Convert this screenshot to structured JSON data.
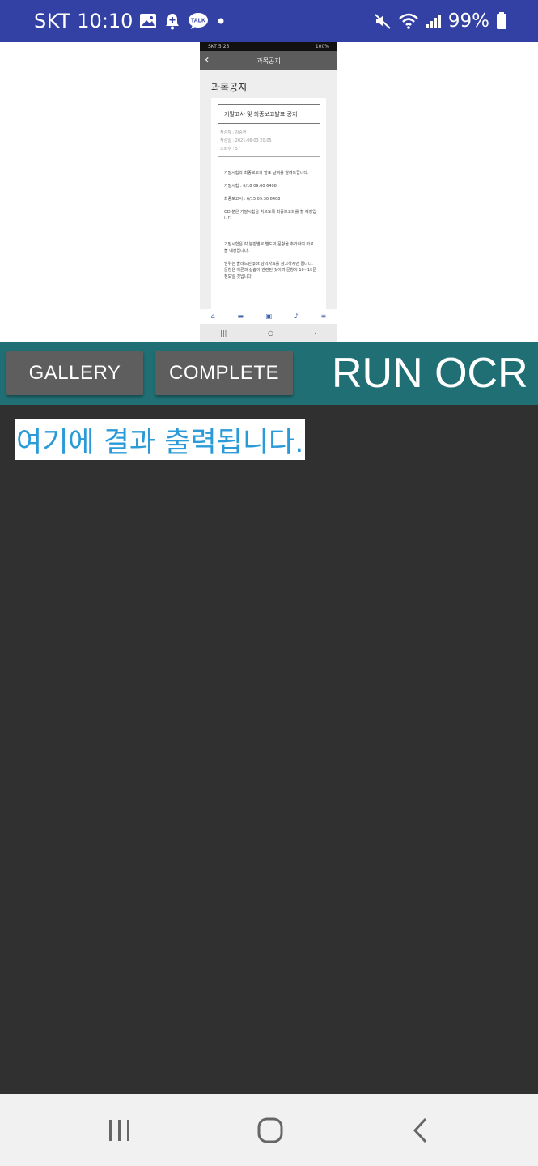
{
  "status_bar": {
    "carrier": "SKT",
    "time": "10:10",
    "battery": "99%",
    "left_icons": [
      "gallery-icon",
      "notification-icon",
      "talk-icon",
      "dot-icon"
    ],
    "talk_badge": "TALK",
    "right_icons": [
      "mute-icon",
      "wifi-icon",
      "signal-icon",
      "battery-icon"
    ]
  },
  "preview": {
    "status_left": "SKT 5:25",
    "status_right": "100%",
    "header_title": "과목공지",
    "page_title": "과목공지",
    "card_title": "기말고사 및 최종보고발표 공지",
    "meta": [
      "작성자 : 강승현",
      "작성일 : 2021-06-03 20:05",
      "조회수 : 57"
    ],
    "paragraphs": [
      "기말시험과 최종보고의 발표 날짜를 알려드립니다.",
      "기말시험 : 6/18 09:00 6408",
      "최종보고서 : 6/15 09:30 6408",
      "ODI분은 기말시험을 치르도록 최종보고회를 할 예정입니다.",
      "기말시험은 각 분반별로 별도의 문항을 추가하여 따로 볼 예정입니다.",
      "범위는 올려드린 ppt 강의자료를 참고하시면 됩니다. 문항은 이론과 실습이 관련된 것이며 문항이 10~15문 정도일 것입니다."
    ]
  },
  "toolbar": {
    "gallery_label": "GALLERY",
    "complete_label": "COMPLETE",
    "run_label": "RUN OCR"
  },
  "result": {
    "text": "여기에 결과 출력됩니다."
  },
  "colors": {
    "status_bar": "#3341a4",
    "toolbar": "#1f6f74",
    "button": "#5e5e5e",
    "result_text": "#2a9ad8",
    "background": "#303030"
  },
  "nav": {
    "icons": [
      "recent-apps-icon",
      "home-icon",
      "back-icon"
    ]
  }
}
